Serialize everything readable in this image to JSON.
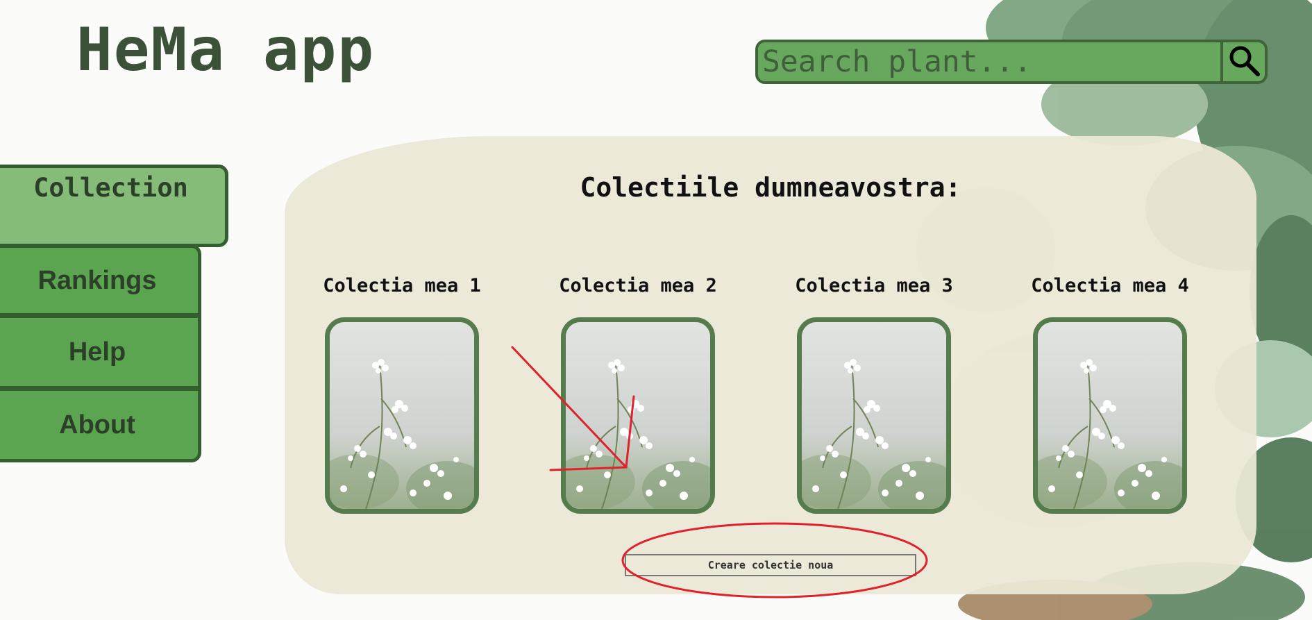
{
  "header": {
    "app_title": "HeMa app"
  },
  "search": {
    "placeholder": "Search plant...",
    "value": "",
    "icon": "search-icon"
  },
  "sidebar": {
    "items": [
      {
        "label": "Collection",
        "active": true
      },
      {
        "label": "Rankings",
        "active": false
      },
      {
        "label": "Help",
        "active": false
      },
      {
        "label": "About",
        "active": false
      }
    ]
  },
  "main": {
    "title": "Colectiile dumneavostra:",
    "collections": [
      {
        "label": "Colectia mea 1"
      },
      {
        "label": "Colectia mea 2"
      },
      {
        "label": "Colectia mea 3"
      },
      {
        "label": "Colectia mea 4"
      }
    ],
    "create_button_label": "Creare colectie noua"
  },
  "colors": {
    "brand_green": "#5ca550",
    "active_tab_green": "#85bd78",
    "border_green": "#355e30",
    "panel_beige": "#ece8d6",
    "annotation_red": "#e0202a"
  }
}
